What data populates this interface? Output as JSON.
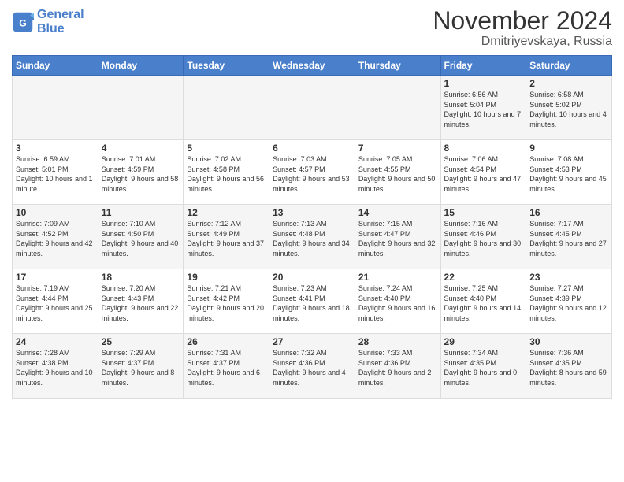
{
  "header": {
    "logo_line1": "General",
    "logo_line2": "Blue",
    "month": "November 2024",
    "location": "Dmitriyevskaya, Russia"
  },
  "weekdays": [
    "Sunday",
    "Monday",
    "Tuesday",
    "Wednesday",
    "Thursday",
    "Friday",
    "Saturday"
  ],
  "weeks": [
    [
      {
        "day": "",
        "info": ""
      },
      {
        "day": "",
        "info": ""
      },
      {
        "day": "",
        "info": ""
      },
      {
        "day": "",
        "info": ""
      },
      {
        "day": "",
        "info": ""
      },
      {
        "day": "1",
        "info": "Sunrise: 6:56 AM\nSunset: 5:04 PM\nDaylight: 10 hours and 7 minutes."
      },
      {
        "day": "2",
        "info": "Sunrise: 6:58 AM\nSunset: 5:02 PM\nDaylight: 10 hours and 4 minutes."
      }
    ],
    [
      {
        "day": "3",
        "info": "Sunrise: 6:59 AM\nSunset: 5:01 PM\nDaylight: 10 hours and 1 minute."
      },
      {
        "day": "4",
        "info": "Sunrise: 7:01 AM\nSunset: 4:59 PM\nDaylight: 9 hours and 58 minutes."
      },
      {
        "day": "5",
        "info": "Sunrise: 7:02 AM\nSunset: 4:58 PM\nDaylight: 9 hours and 56 minutes."
      },
      {
        "day": "6",
        "info": "Sunrise: 7:03 AM\nSunset: 4:57 PM\nDaylight: 9 hours and 53 minutes."
      },
      {
        "day": "7",
        "info": "Sunrise: 7:05 AM\nSunset: 4:55 PM\nDaylight: 9 hours and 50 minutes."
      },
      {
        "day": "8",
        "info": "Sunrise: 7:06 AM\nSunset: 4:54 PM\nDaylight: 9 hours and 47 minutes."
      },
      {
        "day": "9",
        "info": "Sunrise: 7:08 AM\nSunset: 4:53 PM\nDaylight: 9 hours and 45 minutes."
      }
    ],
    [
      {
        "day": "10",
        "info": "Sunrise: 7:09 AM\nSunset: 4:52 PM\nDaylight: 9 hours and 42 minutes."
      },
      {
        "day": "11",
        "info": "Sunrise: 7:10 AM\nSunset: 4:50 PM\nDaylight: 9 hours and 40 minutes."
      },
      {
        "day": "12",
        "info": "Sunrise: 7:12 AM\nSunset: 4:49 PM\nDaylight: 9 hours and 37 minutes."
      },
      {
        "day": "13",
        "info": "Sunrise: 7:13 AM\nSunset: 4:48 PM\nDaylight: 9 hours and 34 minutes."
      },
      {
        "day": "14",
        "info": "Sunrise: 7:15 AM\nSunset: 4:47 PM\nDaylight: 9 hours and 32 minutes."
      },
      {
        "day": "15",
        "info": "Sunrise: 7:16 AM\nSunset: 4:46 PM\nDaylight: 9 hours and 30 minutes."
      },
      {
        "day": "16",
        "info": "Sunrise: 7:17 AM\nSunset: 4:45 PM\nDaylight: 9 hours and 27 minutes."
      }
    ],
    [
      {
        "day": "17",
        "info": "Sunrise: 7:19 AM\nSunset: 4:44 PM\nDaylight: 9 hours and 25 minutes."
      },
      {
        "day": "18",
        "info": "Sunrise: 7:20 AM\nSunset: 4:43 PM\nDaylight: 9 hours and 22 minutes."
      },
      {
        "day": "19",
        "info": "Sunrise: 7:21 AM\nSunset: 4:42 PM\nDaylight: 9 hours and 20 minutes."
      },
      {
        "day": "20",
        "info": "Sunrise: 7:23 AM\nSunset: 4:41 PM\nDaylight: 9 hours and 18 minutes."
      },
      {
        "day": "21",
        "info": "Sunrise: 7:24 AM\nSunset: 4:40 PM\nDaylight: 9 hours and 16 minutes."
      },
      {
        "day": "22",
        "info": "Sunrise: 7:25 AM\nSunset: 4:40 PM\nDaylight: 9 hours and 14 minutes."
      },
      {
        "day": "23",
        "info": "Sunrise: 7:27 AM\nSunset: 4:39 PM\nDaylight: 9 hours and 12 minutes."
      }
    ],
    [
      {
        "day": "24",
        "info": "Sunrise: 7:28 AM\nSunset: 4:38 PM\nDaylight: 9 hours and 10 minutes."
      },
      {
        "day": "25",
        "info": "Sunrise: 7:29 AM\nSunset: 4:37 PM\nDaylight: 9 hours and 8 minutes."
      },
      {
        "day": "26",
        "info": "Sunrise: 7:31 AM\nSunset: 4:37 PM\nDaylight: 9 hours and 6 minutes."
      },
      {
        "day": "27",
        "info": "Sunrise: 7:32 AM\nSunset: 4:36 PM\nDaylight: 9 hours and 4 minutes."
      },
      {
        "day": "28",
        "info": "Sunrise: 7:33 AM\nSunset: 4:36 PM\nDaylight: 9 hours and 2 minutes."
      },
      {
        "day": "29",
        "info": "Sunrise: 7:34 AM\nSunset: 4:35 PM\nDaylight: 9 hours and 0 minutes."
      },
      {
        "day": "30",
        "info": "Sunrise: 7:36 AM\nSunset: 4:35 PM\nDaylight: 8 hours and 59 minutes."
      }
    ]
  ]
}
